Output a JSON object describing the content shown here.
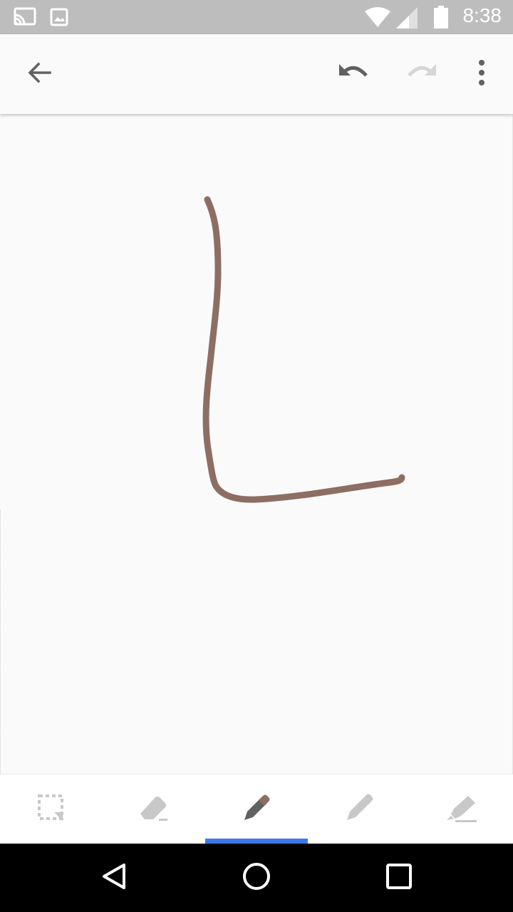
{
  "status_bar": {
    "time": "8:38",
    "icons": [
      "cast-icon",
      "image-icon",
      "wifi-icon",
      "signal-icon",
      "battery-icon"
    ]
  },
  "app_bar": {
    "icons": [
      "back-arrow-icon",
      "undo-icon",
      "redo-icon",
      "more-vert-icon"
    ],
    "redo_enabled": false
  },
  "drawing": {
    "stroke_color": "#8d6e63",
    "shape": "letter L"
  },
  "tools": [
    {
      "name": "lasso-select",
      "icon": "lasso-select-icon",
      "selected": false
    },
    {
      "name": "eraser",
      "icon": "eraser-icon",
      "selected": false
    },
    {
      "name": "pen",
      "icon": "pen-icon",
      "selected": true,
      "color": "#8d6e63"
    },
    {
      "name": "marker",
      "icon": "marker-icon",
      "selected": false
    },
    {
      "name": "highlighter",
      "icon": "highlighter-icon",
      "selected": false
    }
  ],
  "colors": {
    "accent": "#3b78e7",
    "status_bar": "#bdbdbd",
    "icon_active": "#616161",
    "icon_inactive": "#c8c8c8"
  },
  "nav_bar": {
    "icons": [
      "nav-back-icon",
      "nav-home-icon",
      "nav-recents-icon"
    ]
  }
}
